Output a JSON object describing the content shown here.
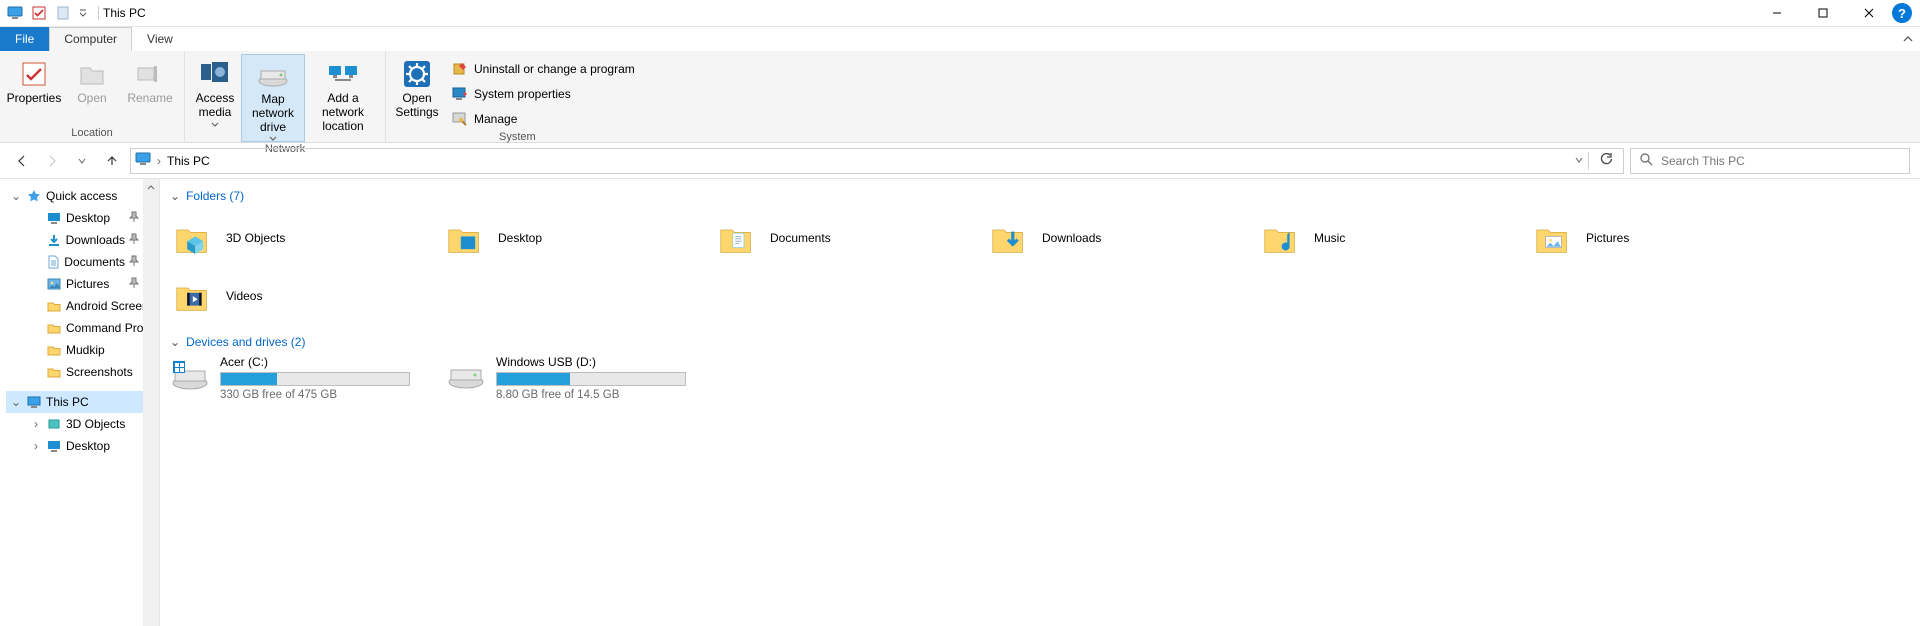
{
  "window": {
    "title": "This PC"
  },
  "tabs": {
    "file": "File",
    "computer": "Computer",
    "view": "View"
  },
  "ribbon": {
    "location": {
      "properties": "Properties",
      "open": "Open",
      "rename": "Rename",
      "group": "Location"
    },
    "network": {
      "access_media": "Access media",
      "map_drive": "Map network drive",
      "add_location": "Add a network location",
      "group": "Network"
    },
    "system": {
      "open_settings": "Open Settings",
      "uninstall": "Uninstall or change a program",
      "sys_props": "System properties",
      "manage": "Manage",
      "group": "System"
    }
  },
  "address": {
    "location": "This PC"
  },
  "search": {
    "placeholder": "Search This PC"
  },
  "nav": {
    "quick_access": "Quick access",
    "qa_items": [
      {
        "label": "Desktop",
        "pinned": true,
        "icon": "desktop"
      },
      {
        "label": "Downloads",
        "pinned": true,
        "icon": "downloads"
      },
      {
        "label": "Documents",
        "pinned": true,
        "icon": "documents"
      },
      {
        "label": "Pictures",
        "pinned": true,
        "icon": "pictures"
      },
      {
        "label": "Android Screens",
        "pinned": false,
        "icon": "folder"
      },
      {
        "label": "Command Prom",
        "pinned": false,
        "icon": "folder"
      },
      {
        "label": "Mudkip",
        "pinned": false,
        "icon": "folder"
      },
      {
        "label": "Screenshots",
        "pinned": false,
        "icon": "folder"
      }
    ],
    "this_pc": "This PC",
    "pc_items": [
      {
        "label": "3D Objects"
      },
      {
        "label": "Desktop"
      }
    ]
  },
  "sections": {
    "folders_label": "Folders (7)",
    "drives_label": "Devices and drives (2)"
  },
  "folders": [
    {
      "label": "3D Objects",
      "kind": "3d"
    },
    {
      "label": "Desktop",
      "kind": "desktop"
    },
    {
      "label": "Documents",
      "kind": "documents"
    },
    {
      "label": "Downloads",
      "kind": "downloads"
    },
    {
      "label": "Music",
      "kind": "music"
    },
    {
      "label": "Pictures",
      "kind": "pictures"
    },
    {
      "label": "Videos",
      "kind": "videos"
    }
  ],
  "drives": [
    {
      "label": "Acer (C:)",
      "free_text": "330 GB free of 475 GB",
      "fill_pct": 30
    },
    {
      "label": "Windows USB (D:)",
      "free_text": "8.80 GB free of 14.5 GB",
      "fill_pct": 39
    }
  ]
}
